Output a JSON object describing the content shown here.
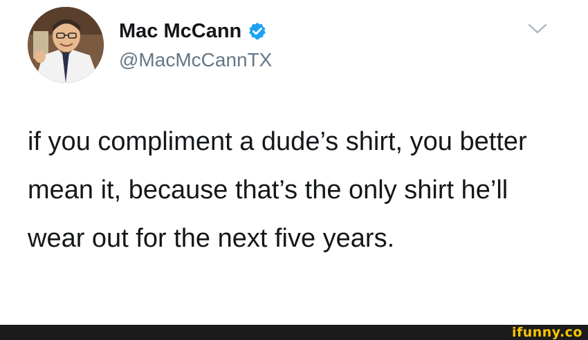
{
  "tweet": {
    "author": {
      "display_name": "Mac McCann",
      "handle": "@MacMcCannTX",
      "verified": true
    },
    "text": "if you compliment a dude’s shirt, you better mean it, because that’s the only shirt he’ll wear out for the next five years."
  },
  "icons": {
    "verified": "verified-badge-icon",
    "menu": "chevron-down-icon"
  },
  "watermark": {
    "text": "ifunny.co"
  },
  "colors": {
    "name": "#14171a",
    "handle": "#657786",
    "verified": "#1da1f2",
    "watermark": "#f7c600",
    "footer": "#1b1b1b"
  }
}
